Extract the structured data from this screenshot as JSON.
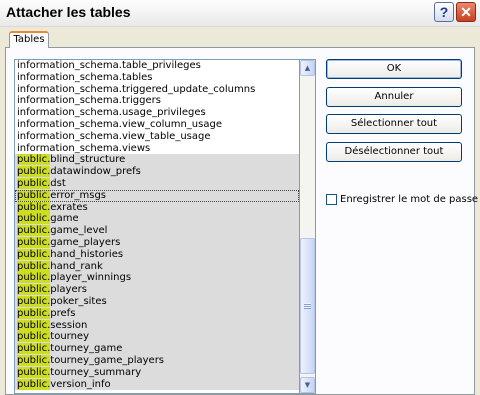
{
  "window": {
    "title": "Attacher les tables",
    "help_glyph": "?",
    "close_glyph": "✕"
  },
  "tab": {
    "label": "Tables"
  },
  "tables": [
    {
      "prefix": "information_schema.",
      "name": "table_privileges",
      "selected": false,
      "focused": false
    },
    {
      "prefix": "information_schema.",
      "name": "tables",
      "selected": false,
      "focused": false
    },
    {
      "prefix": "information_schema.",
      "name": "triggered_update_columns",
      "selected": false,
      "focused": false
    },
    {
      "prefix": "information_schema.",
      "name": "triggers",
      "selected": false,
      "focused": false
    },
    {
      "prefix": "information_schema.",
      "name": "usage_privileges",
      "selected": false,
      "focused": false
    },
    {
      "prefix": "information_schema.",
      "name": "view_column_usage",
      "selected": false,
      "focused": false
    },
    {
      "prefix": "information_schema.",
      "name": "view_table_usage",
      "selected": false,
      "focused": false
    },
    {
      "prefix": "information_schema.",
      "name": "views",
      "selected": false,
      "focused": false
    },
    {
      "prefix": "public.",
      "name": "blind_structure",
      "selected": true,
      "focused": false
    },
    {
      "prefix": "public.",
      "name": "datawindow_prefs",
      "selected": true,
      "focused": false
    },
    {
      "prefix": "public.",
      "name": "dst",
      "selected": true,
      "focused": false
    },
    {
      "prefix": "public.",
      "name": "error_msgs",
      "selected": true,
      "focused": true
    },
    {
      "prefix": "public.",
      "name": "exrates",
      "selected": true,
      "focused": false
    },
    {
      "prefix": "public.",
      "name": "game",
      "selected": true,
      "focused": false
    },
    {
      "prefix": "public.",
      "name": "game_level",
      "selected": true,
      "focused": false
    },
    {
      "prefix": "public.",
      "name": "game_players",
      "selected": true,
      "focused": false
    },
    {
      "prefix": "public.",
      "name": "hand_histories",
      "selected": true,
      "focused": false
    },
    {
      "prefix": "public.",
      "name": "hand_rank",
      "selected": true,
      "focused": false
    },
    {
      "prefix": "public.",
      "name": "player_winnings",
      "selected": true,
      "focused": false
    },
    {
      "prefix": "public.",
      "name": "players",
      "selected": true,
      "focused": false
    },
    {
      "prefix": "public.",
      "name": "poker_sites",
      "selected": true,
      "focused": false
    },
    {
      "prefix": "public.",
      "name": "prefs",
      "selected": true,
      "focused": false
    },
    {
      "prefix": "public.",
      "name": "session",
      "selected": true,
      "focused": false
    },
    {
      "prefix": "public.",
      "name": "tourney",
      "selected": true,
      "focused": false
    },
    {
      "prefix": "public.",
      "name": "tourney_game",
      "selected": true,
      "focused": false
    },
    {
      "prefix": "public.",
      "name": "tourney_game_players",
      "selected": true,
      "focused": false
    },
    {
      "prefix": "public.",
      "name": "tourney_summary",
      "selected": true,
      "focused": false
    },
    {
      "prefix": "public.",
      "name": "version_info",
      "selected": true,
      "focused": false
    }
  ],
  "scrollbar": {
    "up_glyph": "▲",
    "down_glyph": "▼"
  },
  "buttons": {
    "ok": "OK",
    "cancel": "Annuler",
    "select_all": "Sélectionner tout",
    "deselect_all": "Désélectionner tout"
  },
  "save_password": {
    "label": "Enregistrer le mot de passe",
    "checked": false
  },
  "colors": {
    "highlight": "#ccdd22",
    "selection": "#dcdcdc",
    "dialog_bg": "#ece9d8"
  }
}
